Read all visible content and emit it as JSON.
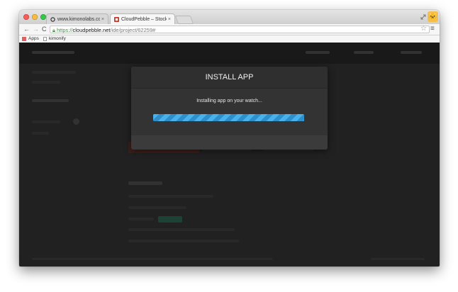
{
  "browser": {
    "tabs": [
      {
        "label": "www.kimonolabs.com/ap",
        "close": "×"
      },
      {
        "label": "CloudPebble – Stock Ticke",
        "close": "×"
      }
    ],
    "url_scheme": "https://",
    "url_host": "cloudpebble.net",
    "url_path": "/ide/project/62259#",
    "bookmarks": [
      {
        "label": "Apps",
        "icon": "apps-icon"
      },
      {
        "label": "kimonify",
        "icon": "page-icon"
      }
    ],
    "nav": {
      "back": "←",
      "forward": "→",
      "reload": "C"
    },
    "icons": {
      "star": "☆",
      "menu": "≡",
      "lock": "🔒",
      "profile": "🐱"
    }
  },
  "modal": {
    "title": "INSTALL APP",
    "message": "Installing app on your watch...",
    "progress_percent": 100
  },
  "colors": {
    "progress": "#3fa4de",
    "https": "#2f9f2f",
    "overlay_bg": "#2e2e2e"
  }
}
